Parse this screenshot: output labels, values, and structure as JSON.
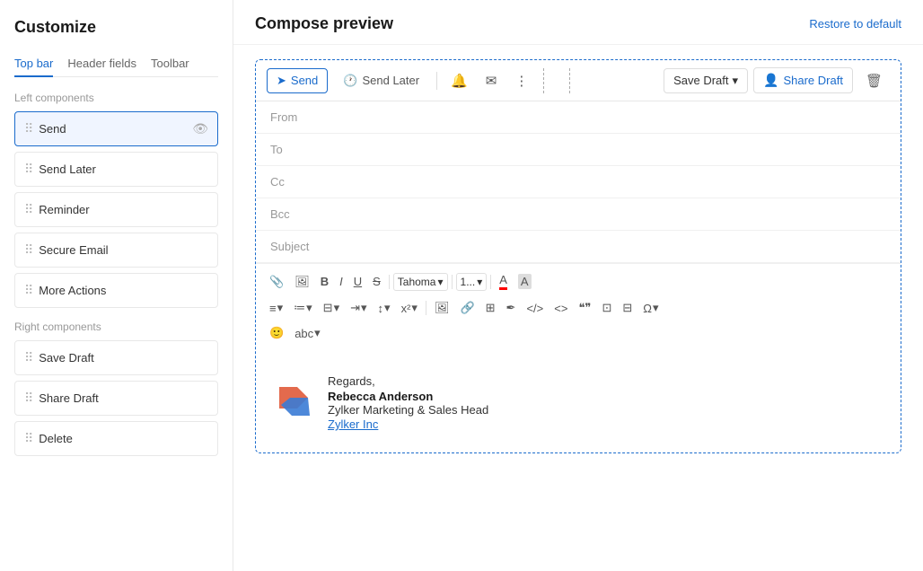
{
  "sidebar": {
    "title": "Customize",
    "tabs": [
      {
        "id": "top-bar",
        "label": "Top bar",
        "active": true
      },
      {
        "id": "header-fields",
        "label": "Header fields",
        "active": false
      },
      {
        "id": "toolbar",
        "label": "Toolbar",
        "active": false
      }
    ],
    "left_section_label": "Left components",
    "left_components": [
      {
        "id": "send",
        "label": "Send",
        "active": true,
        "has_eye": true
      },
      {
        "id": "send-later",
        "label": "Send Later",
        "active": false
      },
      {
        "id": "reminder",
        "label": "Reminder",
        "active": false
      },
      {
        "id": "secure-email",
        "label": "Secure Email",
        "active": false
      },
      {
        "id": "more-actions",
        "label": "More Actions",
        "active": false
      }
    ],
    "right_section_label": "Right components",
    "right_components": [
      {
        "id": "save-draft",
        "label": "Save Draft",
        "active": false
      },
      {
        "id": "share-draft",
        "label": "Share Draft",
        "active": false
      },
      {
        "id": "delete",
        "label": "Delete",
        "active": false
      }
    ]
  },
  "main": {
    "title": "Compose preview",
    "restore_link": "Restore to default",
    "compose": {
      "toolbar": {
        "send_label": "Send",
        "send_later_label": "Send Later",
        "save_draft_label": "Save Draft",
        "share_draft_label": "Share Draft"
      },
      "fields": {
        "from_label": "From",
        "to_label": "To",
        "cc_label": "Cc",
        "bcc_label": "Bcc",
        "subject_label": "Subject"
      },
      "font_name": "Tahoma",
      "font_size": "1..."
    },
    "signature": {
      "regards": "Regards,",
      "name": "Rebecca Anderson",
      "title": "Zylker Marketing & Sales Head",
      "company": "Zylker Inc"
    }
  }
}
